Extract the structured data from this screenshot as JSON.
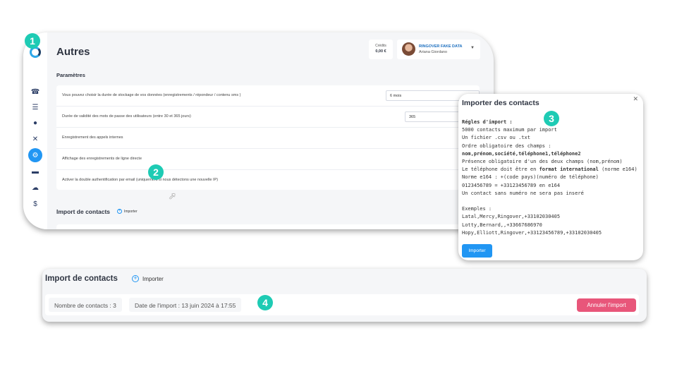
{
  "main_window": {
    "page_title": "Autres",
    "credits": {
      "label": "Crédits",
      "value": "0,00 €"
    },
    "user": {
      "company": "RINGOVER FAKE DATA",
      "name": "Ariana Giordano"
    },
    "sidebar_icons": [
      "phone-icon",
      "list-icon",
      "clock-icon",
      "shuffle-icon",
      "gear-icon",
      "card-icon",
      "cloud-icon",
      "dollar-icon"
    ],
    "section_title": "Paramètres",
    "settings": [
      {
        "label": "Vous pouvez choisir la durée de stockage de vos données (enregistrements / répondeur / contenu sms )",
        "value": "6 mois"
      },
      {
        "label": "Durée de validité des mots de passe des utilisateurs (entre 30 et 365 jours)",
        "value": "365"
      },
      {
        "label": "Enregistrement des appels internes"
      },
      {
        "label": "Affichage des enregistrements de ligne directe"
      },
      {
        "label": "Activer la double authentification par email (uniquement si nous détectons une nouvelle IP)"
      }
    ],
    "import_title": "Import de contacts",
    "import_button": "Importer"
  },
  "dialog": {
    "title": "Importer des contacts",
    "rules": {
      "heading": "Régles d'import :",
      "line1": "5000 contacts maximum par import",
      "line2": "Un fichier .csv ou .txt",
      "line3": "Ordre obligatoire des champs :",
      "line4": "nom,prénom,société,téléphone1,téléphone2",
      "line5": "Présence obligatoire d'un des deux champs (nom,prénom)",
      "line6_pre": "Le téléphone doit être en ",
      "line6_bold": "format international",
      "line6_post": " (norme e164)",
      "line7": "Norme e164 : +(code pays)(numéro de téléphone)",
      "line8": "0123456789 = +33123456789 en e164",
      "line9": "Un contact sans numéro ne sera pas inseré",
      "examples_heading": "Exemples :",
      "example1": "Latal,Mercy,Ringover,+33102030405",
      "example2": "Lotty,Bernard,,+33667686970",
      "example3": "Hopy,Elliott,Ringover,+33123456789,+33102030405"
    },
    "import_button": "Importer"
  },
  "import_panel": {
    "title": "Import de contacts",
    "import_button": "Importer",
    "contact_count": "Nombre de contacts : 3",
    "import_date": "Date de l'import : 13 juin 2024 à 17:55",
    "cancel_button": "Annuler l'import"
  },
  "badges": [
    "1",
    "2",
    "3",
    "4"
  ],
  "colors": {
    "primary": "#2196f3",
    "danger": "#e8567a",
    "badge": "#1ecbb4"
  }
}
